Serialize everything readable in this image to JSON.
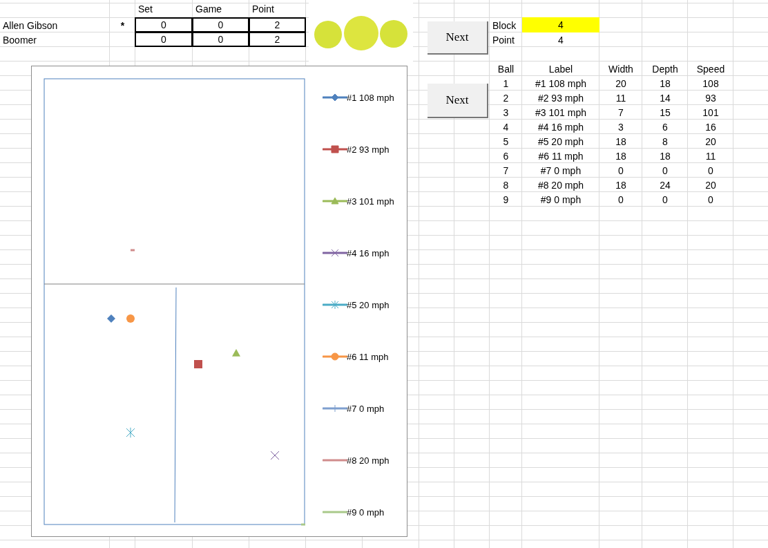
{
  "score_columns": [
    "Set",
    "Game",
    "Point"
  ],
  "players": [
    {
      "name": "Allen Gibson",
      "serve_mark": "*",
      "set": "0",
      "game": "0",
      "point": "2"
    },
    {
      "name": "Boomer",
      "set": "0",
      "game": "0",
      "point": "2"
    }
  ],
  "buttons": [
    "Next",
    "Next"
  ],
  "status": [
    {
      "label": "Block",
      "value": "4",
      "highlighted": true
    },
    {
      "label": "Point",
      "value": "4",
      "highlighted": false
    }
  ],
  "balls": {
    "columns": [
      "Ball",
      "Label",
      "Width",
      "Depth",
      "Speed"
    ],
    "rows": [
      [
        "1",
        "#1 108 mph",
        "20",
        "18",
        "108"
      ],
      [
        "2",
        "#2 93 mph",
        "11",
        "14",
        "93"
      ],
      [
        "3",
        "#3 101 mph",
        "7",
        "15",
        "101"
      ],
      [
        "4",
        "#4 16 mph",
        "3",
        "6",
        "16"
      ],
      [
        "5",
        "#5 20 mph",
        "18",
        "8",
        "20"
      ],
      [
        "6",
        "#6 11 mph",
        "18",
        "18",
        "11"
      ],
      [
        "7",
        "#7 0 mph",
        "0",
        "0",
        "0"
      ],
      [
        "8",
        "#8 20 mph",
        "18",
        "24",
        "20"
      ],
      [
        "9",
        "#9 0 mph",
        "0",
        "0",
        "0"
      ]
    ]
  },
  "chart": {
    "legend": [
      {
        "label": "#1 108 mph",
        "color": "#4f81bd",
        "kind": "diamond"
      },
      {
        "label": "#2 93 mph",
        "color": "#c0504d",
        "kind": "square"
      },
      {
        "label": "#3 101 mph",
        "color": "#9bbb59",
        "kind": "triangle"
      },
      {
        "label": "#4 16 mph",
        "color": "#8064a2",
        "kind": "cross"
      },
      {
        "label": "#5 20 mph",
        "color": "#4bacc6",
        "kind": "asterisk"
      },
      {
        "label": "#6 11 mph",
        "color": "#f79646",
        "kind": "circle"
      },
      {
        "label": "#7 0 mph",
        "color": "#7f9fcf",
        "kind": "plus"
      },
      {
        "label": "#8 20 mph",
        "color": "#d08c8c",
        "kind": "none"
      },
      {
        "label": "#9 0 mph",
        "color": "#a9c98a",
        "kind": "none"
      }
    ]
  }
}
